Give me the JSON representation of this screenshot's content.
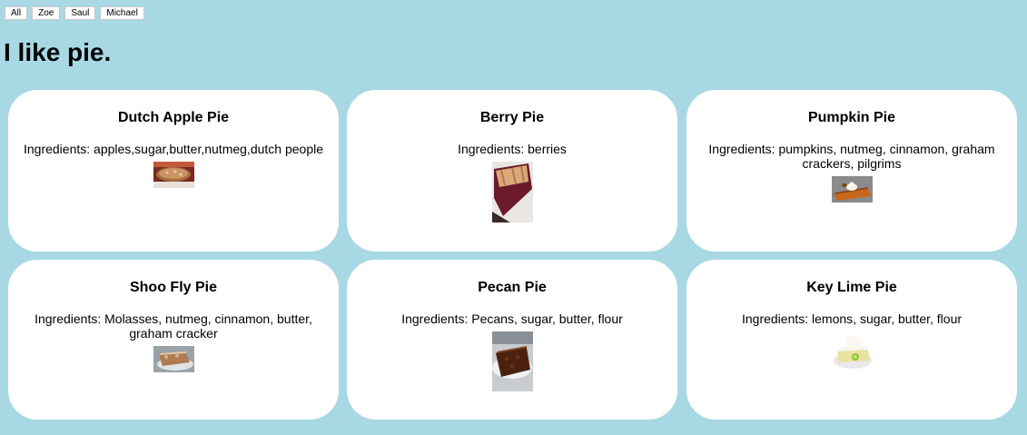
{
  "filters": [
    "All",
    "Zoe",
    "Saul",
    "Michael"
  ],
  "page": {
    "title": "I like pie."
  },
  "pies": [
    {
      "name": "Dutch Apple Pie",
      "ingredients": "Ingredients: apples,sugar,butter,nutmeg,dutch people",
      "image": "dutch-apple-pie-photo"
    },
    {
      "name": "Berry Pie",
      "ingredients": "Ingredients: berries",
      "image": "berry-pie-photo"
    },
    {
      "name": "Pumpkin Pie",
      "ingredients": "Ingredients: pumpkins, nutmeg, cinnamon, graham crackers, pilgrims",
      "image": "pumpkin-pie-photo"
    },
    {
      "name": "Shoo Fly Pie",
      "ingredients": "Ingredients: Molasses, nutmeg, cinnamon, butter, graham cracker",
      "image": "shoo-fly-pie-photo"
    },
    {
      "name": "Pecan Pie",
      "ingredients": "Ingredients: Pecans, sugar, butter, flour",
      "image": "pecan-pie-photo"
    },
    {
      "name": "Key Lime Pie",
      "ingredients": "Ingredients: lemons, sugar, butter, flour",
      "image": "key-lime-pie-photo"
    }
  ],
  "colors": {
    "background": "#a8d8e4",
    "card": "#ffffff"
  }
}
